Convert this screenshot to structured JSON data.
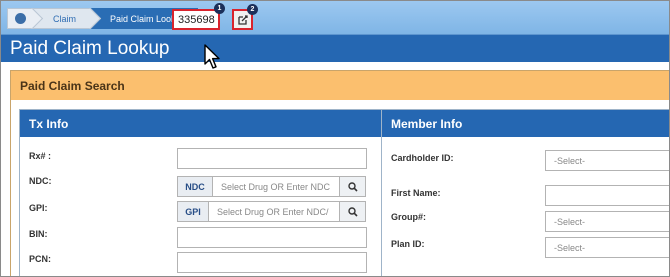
{
  "breadcrumb": {
    "home_icon": "home-icon",
    "items": [
      "Claim",
      "Paid Claim Lookup"
    ]
  },
  "claim_number_field": {
    "value": "335698",
    "badge": "1"
  },
  "edit_button": {
    "icon": "edit-external-icon",
    "badge": "2"
  },
  "page_title": "Paid Claim Lookup",
  "search_panel": {
    "title": "Paid Claim Search"
  },
  "tx_info": {
    "title": "Tx Info",
    "rx_label": "Rx# :",
    "ndc_label": "NDC:",
    "ndc_addon": "NDC",
    "ndc_placeholder": "Select Drug OR Enter NDC",
    "gpi_label": "GPI:",
    "gpi_addon": "GPI",
    "gpi_placeholder": "Select Drug OR Enter NDC/",
    "bin_label": "BIN:",
    "pcn_label": "PCN:"
  },
  "member_info": {
    "title": "Member Info",
    "cardholder_label": "Cardholder ID:",
    "cardholder_value": "-Select-",
    "first_name_label": "First Name:",
    "group_label": "Group#:",
    "group_value": "-Select-",
    "plan_label": "Plan ID:",
    "plan_value": "-Select-"
  },
  "colors": {
    "accent_blue": "#2567b2",
    "search_header": "#fbbf6e",
    "highlight_red": "#d9232d"
  }
}
